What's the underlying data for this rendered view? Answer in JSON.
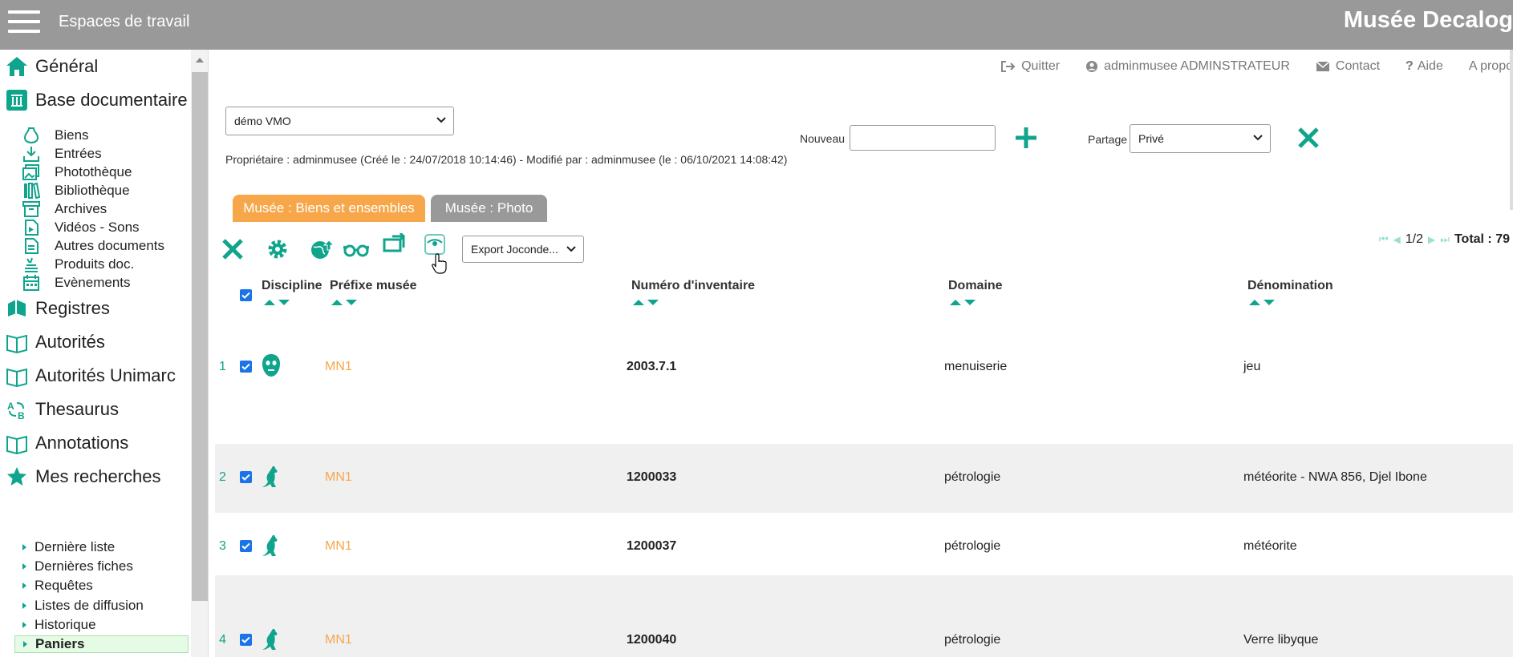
{
  "topbar": {
    "workspace_title": "Espaces de travail",
    "brand": "Musée Decalog"
  },
  "colors": {
    "accent": "#0fa58c",
    "orange": "#f7a74a",
    "topbar": "#999999"
  },
  "sidebar": {
    "main1": [
      {
        "label": "Général",
        "icon": "home-icon"
      },
      {
        "label": "Base documentaire",
        "icon": "museum-icon"
      }
    ],
    "sub": [
      {
        "label": "Biens",
        "icon": "vase-icon"
      },
      {
        "label": "Entrées",
        "icon": "download-icon"
      },
      {
        "label": "Photothèque",
        "icon": "images-icon"
      },
      {
        "label": "Bibliothèque",
        "icon": "books-icon"
      },
      {
        "label": "Archives",
        "icon": "archive-box-icon"
      },
      {
        "label": "Vidéos - Sons",
        "icon": "video-icon"
      },
      {
        "label": "Autres documents",
        "icon": "document-icon"
      },
      {
        "label": "Produits doc.",
        "icon": "stack-icon"
      },
      {
        "label": "Evènements",
        "icon": "calendar-icon"
      }
    ],
    "main2": [
      {
        "label": "Registres",
        "icon": "registers-icon"
      },
      {
        "label": "Autorités",
        "icon": "book-open-icon"
      },
      {
        "label": "Autorités Unimarc",
        "icon": "book-open-icon"
      },
      {
        "label": "Thesaurus",
        "icon": "thesaurus-icon"
      },
      {
        "label": "Annotations",
        "icon": "book-open-icon"
      },
      {
        "label": "Mes recherches",
        "icon": "star-icon"
      }
    ],
    "links": [
      "Dernière liste",
      "Dernières fiches",
      "Requêtes",
      "Listes de diffusion",
      "Historique",
      "Paniers"
    ]
  },
  "toplinks": {
    "quit": "Quitter",
    "user": "adminmusee ADMINSTRATEUR",
    "contact": "Contact",
    "help": "Aide",
    "about": "A propo"
  },
  "basket": {
    "selected": "démo VMO",
    "owner_line": "Propriétaire : adminmusee (Créé le : 24/07/2018 10:14:46) - Modifié par : adminmusee (le : 06/10/2021 14:08:42)",
    "nouveau_label": "Nouveau",
    "nouveau_value": "",
    "partage_label": "Partage",
    "partage_value": "Privé"
  },
  "tabs": {
    "active": "Musée : Biens et ensembles",
    "inactive": "Musée : Photo"
  },
  "toolbar": {
    "export_select": "Export Joconde..."
  },
  "pager": {
    "page": "1/2",
    "total": "Total : 79"
  },
  "columns": [
    "Discipline",
    "Préfixe musée",
    "Numéro d'inventaire",
    "Domaine",
    "Dénomination"
  ],
  "rows": [
    {
      "n": "1",
      "discipline_icon": "mask-icon",
      "prefix": "MN1",
      "inventory": "2003.7.1",
      "domain": "menuiserie",
      "denomination": "jeu"
    },
    {
      "n": "2",
      "discipline_icon": "kangaroo-icon",
      "prefix": "MN1",
      "inventory": "1200033",
      "domain": "pétrologie",
      "denomination": "météorite - NWA 856, Djel Ibone"
    },
    {
      "n": "3",
      "discipline_icon": "kangaroo-icon",
      "prefix": "MN1",
      "inventory": "1200037",
      "domain": "pétrologie",
      "denomination": "météorite"
    },
    {
      "n": "4",
      "discipline_icon": "kangaroo-icon",
      "prefix": "MN1",
      "inventory": "1200040",
      "domain": "pétrologie",
      "denomination": "Verre libyque"
    }
  ]
}
